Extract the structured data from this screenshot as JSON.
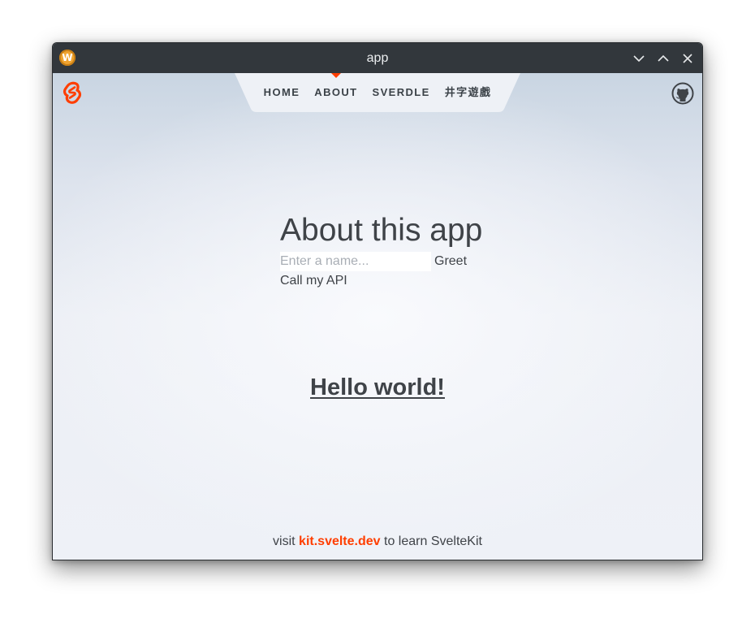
{
  "window": {
    "title": "app",
    "app_icon": "W"
  },
  "nav": {
    "items": [
      {
        "label": "HOME",
        "active": false
      },
      {
        "label": "ABOUT",
        "active": true
      },
      {
        "label": "SVERDLE",
        "active": false
      },
      {
        "label": "井字遊戲",
        "active": false
      }
    ]
  },
  "main": {
    "heading": "About this app",
    "name_input_value": "",
    "name_input_placeholder": "Enter a name...",
    "greet_label": "Greet",
    "api_label": "Call my API",
    "hello_text": "Hello world!"
  },
  "footer": {
    "prefix": "visit",
    "link_text": "kit.svelte.dev",
    "suffix": "to learn SvelteKit"
  },
  "icons": {
    "svelte": "svelte-logo-icon",
    "github": "github-icon",
    "minimize": "chevron-down-icon",
    "maximize": "chevron-up-icon",
    "close": "close-icon"
  },
  "colors": {
    "accent": "#ff3e00",
    "titlebar": "#32373c",
    "text": "#3f4348"
  }
}
